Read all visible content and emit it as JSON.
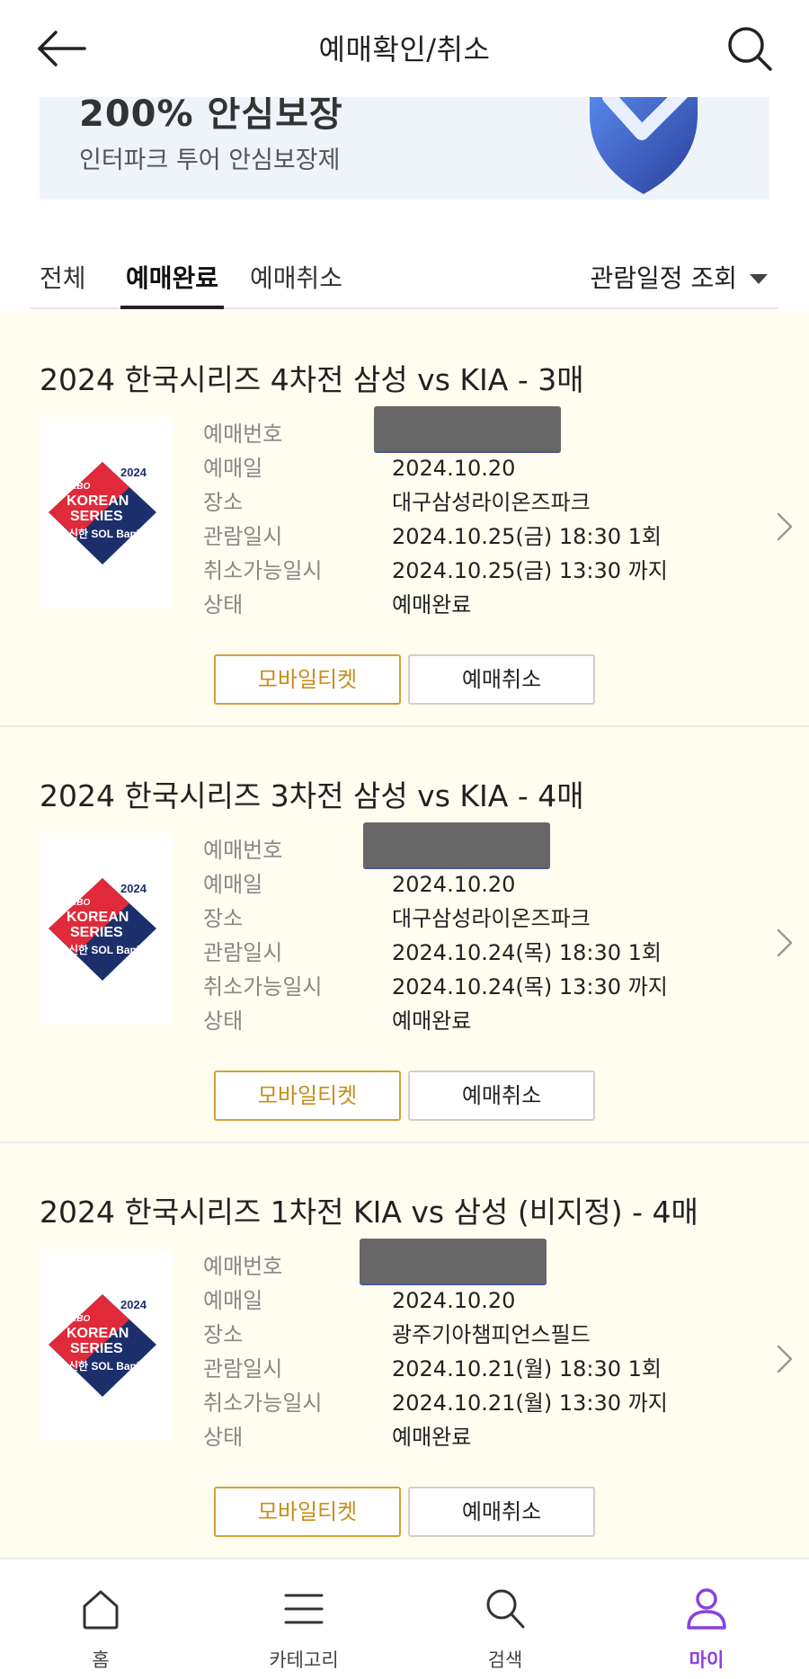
{
  "header": {
    "title": "예매확인/취소"
  },
  "banner": {
    "headline": "200% 안심보장",
    "subtitle": "인터파크 투어 안심보장제"
  },
  "tabs": [
    {
      "label": "전체",
      "active": false
    },
    {
      "label": "예매완료",
      "active": true
    },
    {
      "label": "예매취소",
      "active": false
    }
  ],
  "filter": {
    "label": "관람일정 조회"
  },
  "labels": {
    "booking_no": "예매번호",
    "booking_date": "예매일",
    "venue": "장소",
    "show_time": "관람일시",
    "cancel_deadline": "취소가능일시",
    "status": "상태"
  },
  "thumbnail": {
    "year": "2024",
    "kbo": "KBO",
    "line1": "KOREAN",
    "line2": "SERIES",
    "sponsor": "신한 SOL Bank"
  },
  "bookings": [
    {
      "title": "2024 한국시리즈 4차전 삼성 vs KIA - 3매",
      "booking_date": "2024.10.20",
      "venue": "대구삼성라이온즈파크",
      "show_time": "2024.10.25(금) 18:30 1회",
      "cancel_deadline": "2024.10.25(금) 13:30 까지",
      "status": "예매완료",
      "mobile_ticket": "모바일티켓",
      "cancel": "예매취소"
    },
    {
      "title": "2024 한국시리즈 3차전 삼성 vs KIA - 4매",
      "booking_date": "2024.10.20",
      "venue": "대구삼성라이온즈파크",
      "show_time": "2024.10.24(목) 18:30 1회",
      "cancel_deadline": "2024.10.24(목) 13:30 까지",
      "status": "예매완료",
      "mobile_ticket": "모바일티켓",
      "cancel": "예매취소"
    },
    {
      "title": "2024 한국시리즈 1차전 KIA vs 삼성 (비지정) - 4매",
      "booking_date": "2024.10.20",
      "venue": "광주기아챔피언스필드",
      "show_time": "2024.10.21(월) 18:30 1회",
      "cancel_deadline": "2024.10.21(월) 13:30 까지",
      "status": "예매완료",
      "mobile_ticket": "모바일티켓",
      "cancel": "예매취소"
    }
  ],
  "bottom_nav": [
    {
      "label": "홈",
      "icon": "home-icon",
      "active": false
    },
    {
      "label": "카테고리",
      "icon": "menu-icon",
      "active": false
    },
    {
      "label": "검색",
      "icon": "search-icon",
      "active": false
    },
    {
      "label": "마이",
      "icon": "person-icon",
      "active": true
    }
  ],
  "colors": {
    "accent_purple": "#8b3fe0",
    "ticket_gold": "#c98d16",
    "card_bg": "#fffdf0"
  }
}
